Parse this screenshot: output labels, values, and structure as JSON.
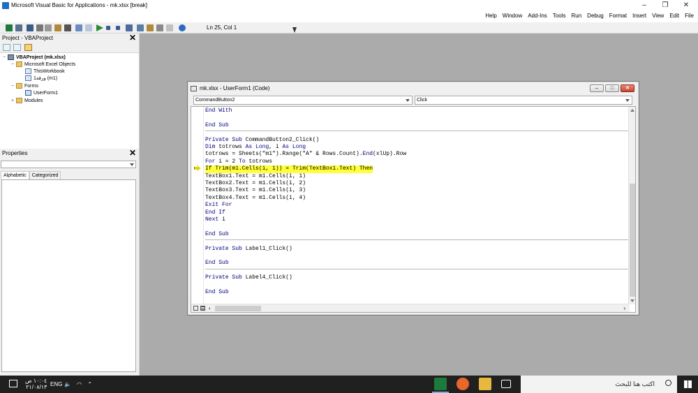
{
  "window": {
    "title": "Microsoft Visual Basic for Applications - mk.xlsx [break]",
    "minimize": "–",
    "maximize": "❐",
    "close": "✕"
  },
  "menu": [
    "File",
    "Edit",
    "View",
    "Insert",
    "Format",
    "Debug",
    "Run",
    "Tools",
    "Add-Ins",
    "Window",
    "Help"
  ],
  "toolbar": {
    "position": "Ln 25, Col 1"
  },
  "project": {
    "title": "Project - VBAProject",
    "close": "✕",
    "tree": [
      {
        "label": "VBAProject (mk.xlsx)",
        "level": 0,
        "icon": "vba-project-icon",
        "expand": "−"
      },
      {
        "label": "Microsoft Excel Objects",
        "level": 1,
        "icon": "folder-icon",
        "expand": "−"
      },
      {
        "label": "ThisWorkbook",
        "level": 2,
        "icon": "workbook-icon",
        "expand": ""
      },
      {
        "label": "ورقة1 (m1)",
        "level": 2,
        "icon": "sheet-icon",
        "expand": ""
      },
      {
        "label": "Forms",
        "level": 1,
        "icon": "folder-icon",
        "expand": "−"
      },
      {
        "label": "UserForm1",
        "level": 2,
        "icon": "userform-icon",
        "expand": ""
      },
      {
        "label": "Modules",
        "level": 1,
        "icon": "folder-icon",
        "expand": "+"
      }
    ]
  },
  "properties": {
    "title": "Properties",
    "close": "✕",
    "tabs": [
      "Alphabetic",
      "Categorized"
    ]
  },
  "code_window": {
    "title": "mk.xlsx - UserForm1 (Code)",
    "object_select": "CommandButton2",
    "procedure_select": "Click",
    "lines": [
      "End With",
      "",
      "End Sub",
      "",
      "Private Sub CommandButton2_Click()",
      "Dim totrows As Long, i As Long",
      "totrows = Sheets(\"m1\").Range(\"A\" & Rows.Count).End(xlUp).Row",
      "For i = 2 To totrows",
      "If Trim(m1.Cells(i, 1)) = Trim(TextBox1.Text) Then",
      "TextBox1.Text = m1.Cells(i, 1)",
      "TextBox2.Text = m1.Cells(i, 2)",
      "TextBox3.Text = m1.Cells(i, 3)",
      "TextBox4.Text = m1.Cells(i, 4)",
      "Exit For",
      "End If",
      "Next i",
      "",
      "End Sub",
      "",
      "Private Sub Label1_Click()",
      "",
      "End Sub",
      "",
      "Private Sub Label4_Click()",
      "",
      "End Sub"
    ],
    "highlighted_line": 8
  },
  "taskbar": {
    "search_placeholder": "اكتب هنا للبحث",
    "time": "١٠:٠٤ ص",
    "date": "٢١/٠٨/١٣",
    "lang": "ENG",
    "tray": "🔈 ◠ ⌃"
  }
}
